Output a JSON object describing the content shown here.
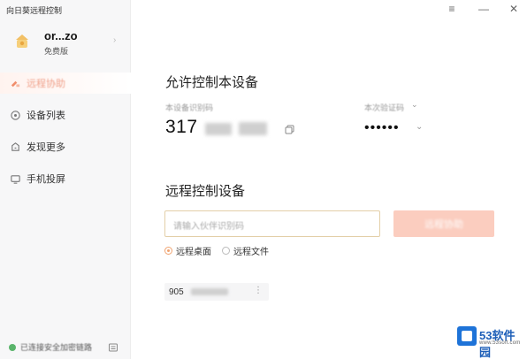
{
  "app": {
    "title": "向日葵远程控制"
  },
  "window": {
    "menu_icon": "≡",
    "min_icon": "—",
    "close_icon": "✕"
  },
  "user": {
    "name": "or...zo",
    "level": "免费版"
  },
  "nav": [
    {
      "label": "远程协助",
      "icon": "remote-icon",
      "active": true
    },
    {
      "label": "设备列表",
      "icon": "device-list-icon",
      "active": false
    },
    {
      "label": "发现更多",
      "icon": "discover-icon",
      "active": false
    },
    {
      "label": "手机投屏",
      "icon": "phone-cast-icon",
      "active": false
    }
  ],
  "footer": {
    "status": "已连接安全加密链路"
  },
  "allow": {
    "title": "允许控制本设备",
    "device_id_label": "本设备识别码",
    "device_id": "317",
    "password_label": "本次验证码",
    "password_mask": "••••••"
  },
  "remote": {
    "title": "远程控制设备",
    "input_placeholder": "请输入伙伴识别码",
    "connect_label": "远程协助",
    "modes": [
      {
        "label": "远程桌面",
        "checked": true
      },
      {
        "label": "远程文件",
        "checked": false
      }
    ]
  },
  "history": [
    {
      "id_prefix": "905"
    }
  ],
  "watermark": {
    "brand": "53软件园",
    "sub": "www.53soft.com"
  },
  "colors": {
    "accent": "#f0a370",
    "button": "#fbcdbf",
    "status": "#5ab46b"
  }
}
